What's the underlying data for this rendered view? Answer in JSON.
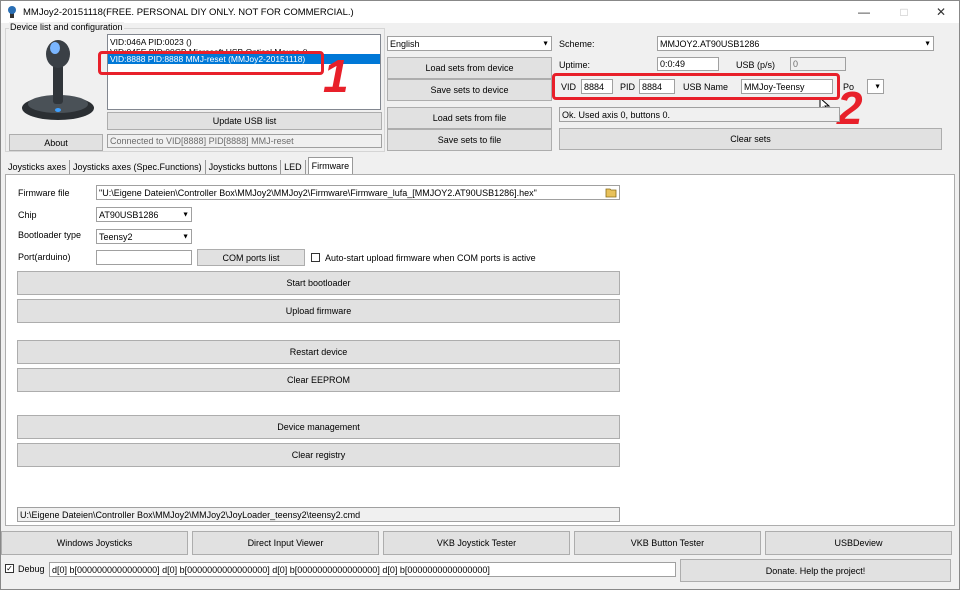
{
  "window": {
    "title": "MMJoy2-20151118(FREE. PERSONAL DIY ONLY. NOT FOR COMMERCIAL.)",
    "minimize": "—",
    "maximize": "□",
    "close": "✕"
  },
  "device_group": {
    "label": "Device list and configuration"
  },
  "devices": [
    "VID:046A PID:0023 ()",
    "VID:045E PID:00CB Microsoft USB Optical Mouse ()",
    "VID:8888 PID:8888 MMJ-reset (MMJoy2-20151118)"
  ],
  "update_usb_label": "Update USB list",
  "about_label": "About",
  "connected_text": "Connected to VID[8888] PID[8888] MMJ-reset",
  "language": {
    "selected": "English"
  },
  "load_sets_device_label": "Load sets from device",
  "save_sets_device_label": "Save sets to device",
  "load_sets_file_label": "Load sets from file",
  "save_sets_file_label": "Save sets to file",
  "scheme": {
    "label": "Scheme:",
    "selected": "MMJOY2.AT90USB1286"
  },
  "uptime": {
    "label": "Uptime:",
    "value": "0:0:49"
  },
  "usb_ps": {
    "label": "USB (p/s)",
    "value": "0"
  },
  "vid": {
    "label": "VID",
    "value": "8884"
  },
  "pid": {
    "label": "PID",
    "value": "8884"
  },
  "usb_name": {
    "label": "USB Name",
    "value": "MMJoy-Teensy"
  },
  "poll_label": "Po",
  "status_text": "Ok.  Used axis  0, buttons 0.",
  "clear_sets_label": "Clear sets",
  "tabs": [
    "Joysticks axes",
    "Joysticks axes (Spec.Functions)",
    "Joysticks buttons",
    "LED",
    "Firmware"
  ],
  "firmware": {
    "file_label": "Firmware file",
    "file_value": "\"U:\\Eigene Dateien\\Controller Box\\MMJoy2\\MMJoy2\\Firmware\\Firmware_lufa_[MMJOY2.AT90USB1286].hex\"",
    "chip_label": "Chip",
    "chip_value": "AT90USB1286",
    "bootloader_label": "Bootloader type",
    "bootloader_value": "Teensy2",
    "port_label": "Port(arduino)",
    "port_value": "",
    "com_ports_label": "COM ports list",
    "autostart_label": "Auto-start upload firmware when COM ports is active",
    "start_bootloader_label": "Start bootloader",
    "upload_firmware_label": "Upload firmware",
    "restart_device_label": "Restart device",
    "clear_eeprom_label": "Clear EEPROM",
    "device_management_label": "Device management",
    "clear_registry_label": "Clear registry",
    "cmd_path": "U:\\Eigene Dateien\\Controller Box\\MMJoy2\\MMJoy2\\JoyLoader_teensy2\\teensy2.cmd"
  },
  "bottom_buttons": [
    "Windows Joysticks",
    "Direct Input Viewer",
    "VKB Joystick Tester",
    "VKB Button Tester",
    "USBDeview"
  ],
  "debug": {
    "label": "Debug",
    "checked": true,
    "value": "d[0] b[0000000000000000]   d[0] b[0000000000000000]   d[0] b[0000000000000000]   d[0] b[0000000000000000]"
  },
  "donate_label": "Donate. Help the project!",
  "annotations": [
    "1",
    "2"
  ],
  "colors": {
    "annotation_red": "#e8202a",
    "selection_blue": "#0078d7"
  }
}
